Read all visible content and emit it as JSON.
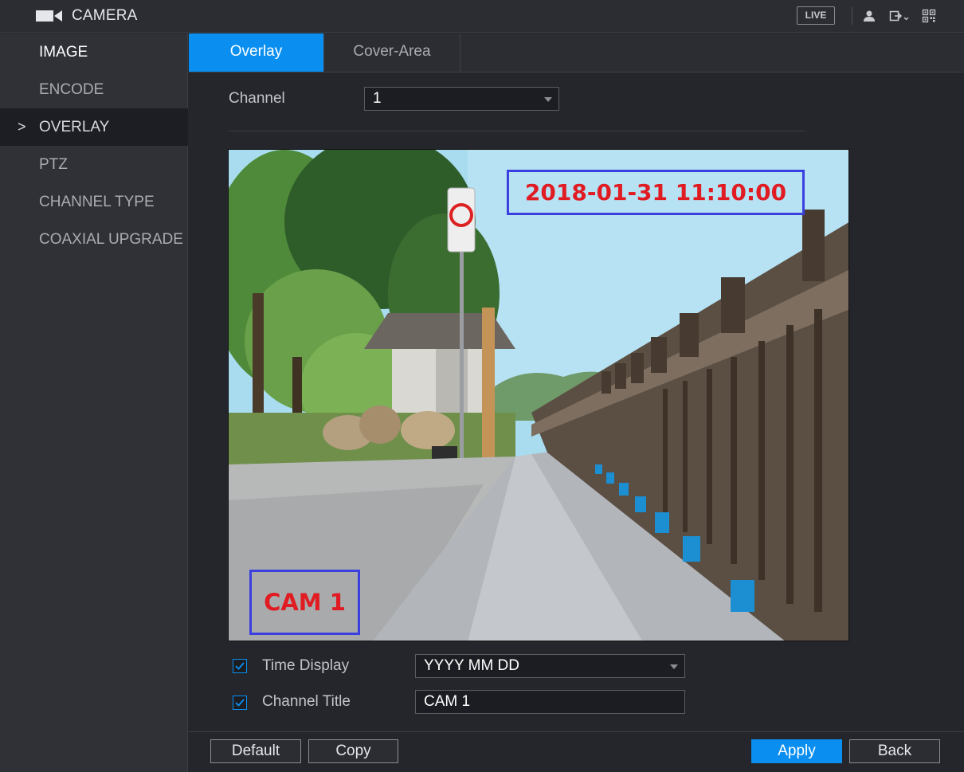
{
  "header": {
    "title": "CAMERA",
    "camera_icon": "video-camera-icon",
    "live_label": "LIVE",
    "icons": [
      "user-icon",
      "logout-icon",
      "qr-code-icon"
    ]
  },
  "sidebar": {
    "items": [
      {
        "label": "IMAGE"
      },
      {
        "label": "ENCODE"
      },
      {
        "label": "OVERLAY",
        "chevron": ">"
      },
      {
        "label": "PTZ"
      },
      {
        "label": "CHANNEL TYPE"
      },
      {
        "label": "COAXIAL UPGRADE"
      }
    ]
  },
  "tabs": [
    {
      "label": "Overlay",
      "active": true
    },
    {
      "label": "Cover-Area",
      "active": false
    }
  ],
  "channel": {
    "label": "Channel",
    "value": "1"
  },
  "preview": {
    "time_overlay": "2018-01-31 11:10:00",
    "title_overlay": "CAM 1"
  },
  "time_display": {
    "checked": true,
    "label": "Time Display",
    "value": "YYYY MM DD"
  },
  "channel_title": {
    "checked": true,
    "label": "Channel Title",
    "value": "CAM 1"
  },
  "buttons": {
    "default": "Default",
    "copy": "Copy",
    "apply": "Apply",
    "back": "Back"
  },
  "colors": {
    "accent": "#0a8ff0",
    "overlay_box": "#3b3fe0",
    "overlay_text": "#e01c22"
  }
}
